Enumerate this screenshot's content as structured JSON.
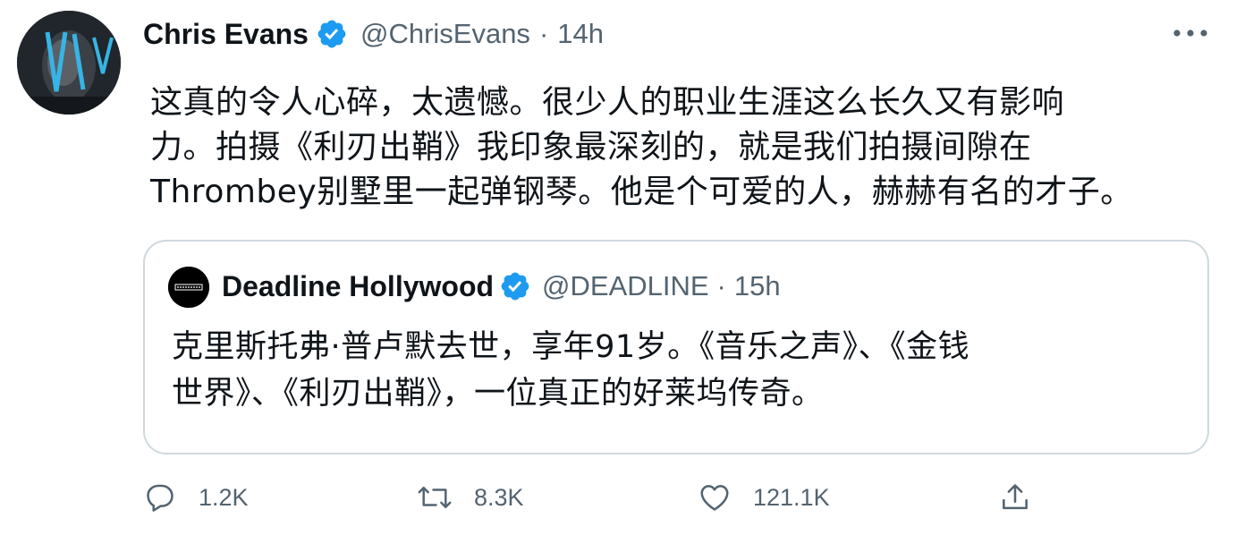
{
  "tweet": {
    "author_name": "Chris Evans",
    "handle": "@ChrisEvans",
    "separator": "·",
    "time": "14h",
    "text_lines": [
      "这真的令人心碎，太遗憾。很少人的职业生涯这么长久又有影响",
      "力。拍摄《利刃出鞘》我印象最深刻的，就是我们拍摄间隙在",
      "Thrombey别墅里一起弹钢琴。他是个可爱的人，赫赫有名的才子。"
    ]
  },
  "quoted_tweet": {
    "author_name": "Deadline Hollywood",
    "handle": "@DEADLINE",
    "separator": "·",
    "time": "15h",
    "text_lines": [
      "克里斯托弗·普卢默去世，享年91岁。《音乐之声》、《金钱",
      "世界》、《利刃出鞘》，一位真正的好莱坞传奇。"
    ]
  },
  "actions": {
    "reply_count": "1.2K",
    "retweet_count": "8.3K",
    "like_count": "121.1K"
  },
  "icons": {
    "avatar": "profile-photo",
    "quoted_avatar": "deadline-logo",
    "verified": "verified-badge-icon",
    "more": "more-horizontal-icon",
    "reply": "reply-icon",
    "retweet": "retweet-icon",
    "like": "heart-icon",
    "share": "share-icon"
  },
  "colors": {
    "verified_blue": "#1d9bf0",
    "secondary_text": "#536471",
    "border": "#cfd9de"
  }
}
